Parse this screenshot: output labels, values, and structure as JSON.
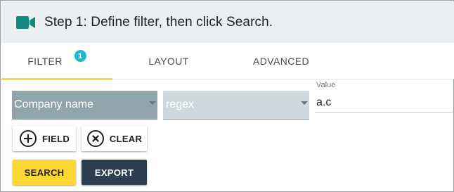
{
  "header": {
    "title": "Step 1: Define filter, then click Search.",
    "icon": "videocam-icon",
    "icon_color": "#128a7f"
  },
  "tabs": [
    {
      "label": "FILTER",
      "badge": "1",
      "active": true
    },
    {
      "label": "LAYOUT",
      "active": false
    },
    {
      "label": "ADVANCED",
      "active": false
    }
  ],
  "filter": {
    "field_select": "Company name",
    "operator_select": "regex",
    "value_label": "Value",
    "value": "a.c"
  },
  "buttons": {
    "field": "FIELD",
    "clear": "CLEAR",
    "search": "SEARCH",
    "export": "EXPORT"
  },
  "colors": {
    "accent": "#fdd835",
    "badge": "#1eb8d0",
    "export_bg": "#2c3e50",
    "field_select_bg": "#90a4ae",
    "operator_select_bg": "#cfd8dc"
  }
}
